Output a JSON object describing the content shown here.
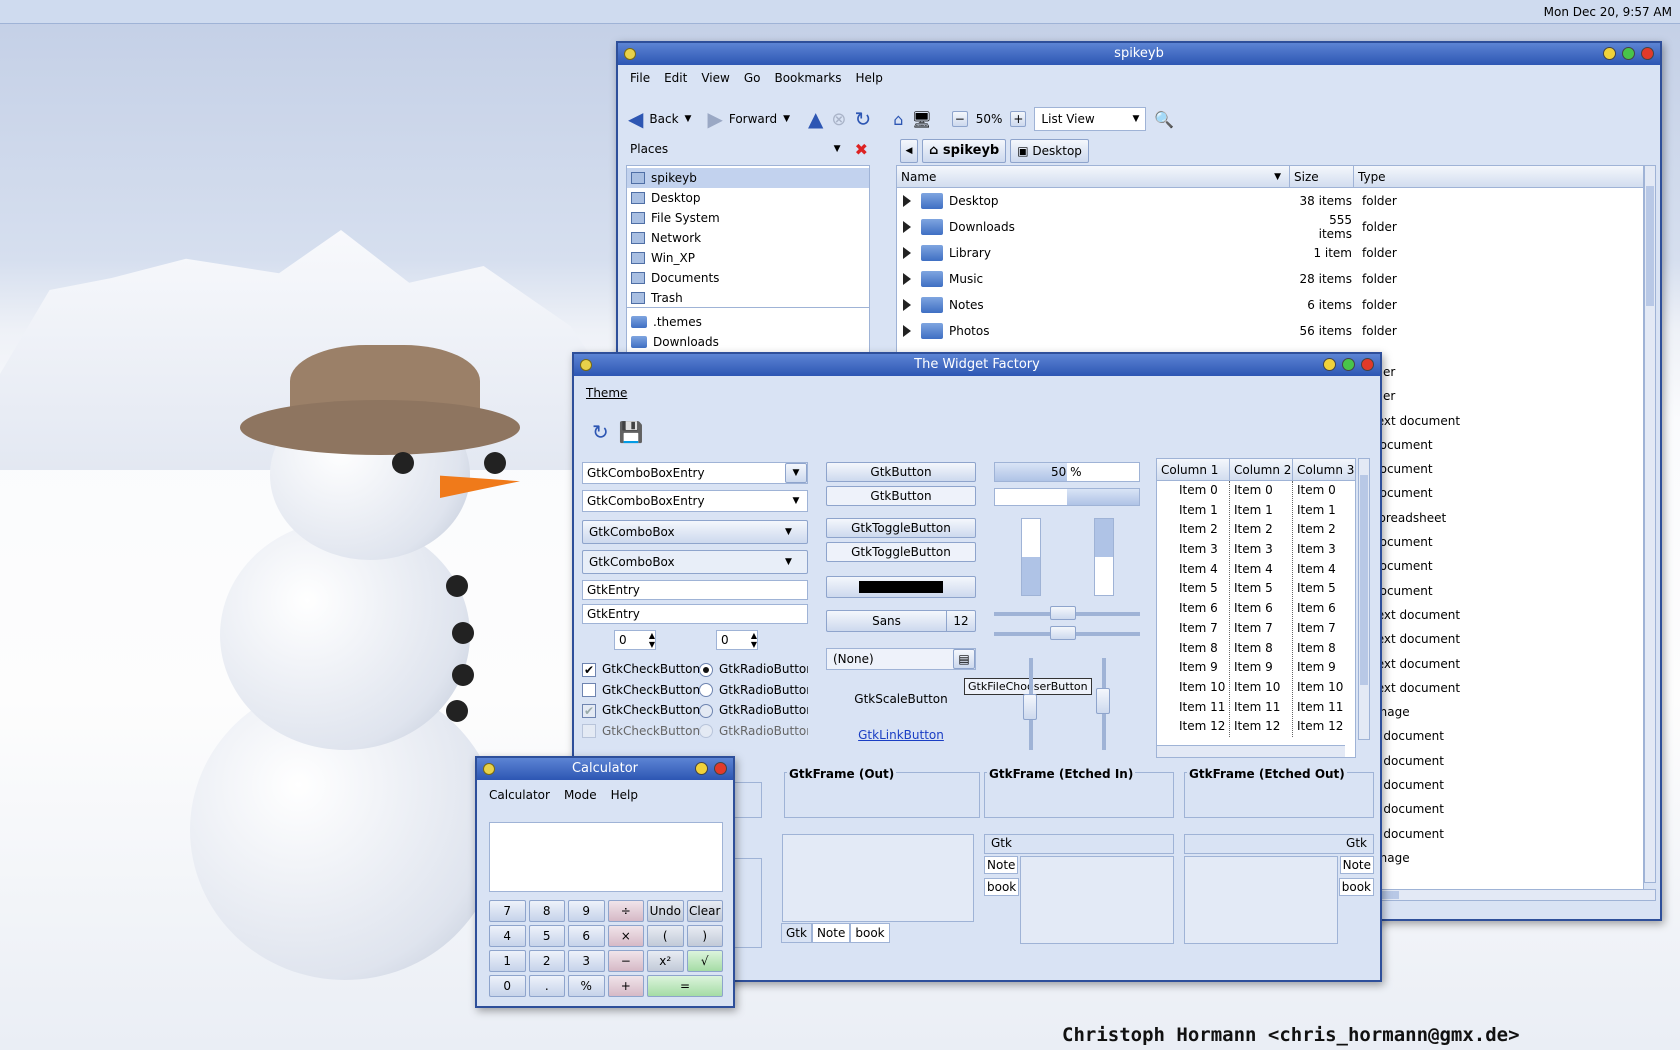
{
  "topbar": {
    "clock": "Mon Dec 20,  9:57 AM"
  },
  "signature": "Christoph Hormann <chris_hormann@gmx.de>",
  "nautilus": {
    "title": "spikeyb",
    "menu": [
      "File",
      "Edit",
      "View",
      "Go",
      "Bookmarks",
      "Help"
    ],
    "toolbar": {
      "back": "Back",
      "forward": "Forward",
      "zoom": "50%",
      "view_mode": "List View"
    },
    "places_label": "Places",
    "path": [
      "spikeyb",
      "Desktop"
    ],
    "places": [
      "spikeyb",
      "Desktop",
      "File System",
      "Network",
      "Win_XP",
      "Documents",
      "Trash"
    ],
    "bookmarks": [
      ".themes",
      "Downloads"
    ],
    "columns": {
      "name": "Name",
      "size": "Size",
      "type": "Type"
    },
    "rows": [
      {
        "name": "Desktop",
        "size": "38 items",
        "type": "folder"
      },
      {
        "name": "Downloads",
        "size": "555 items",
        "type": "folder"
      },
      {
        "name": "Library",
        "size": "1 item",
        "type": "folder"
      },
      {
        "name": "Music",
        "size": "28 items",
        "type": "folder"
      },
      {
        "name": "Notes",
        "size": "6 items",
        "type": "folder"
      },
      {
        "name": "Photos",
        "size": "56 items",
        "type": "folder"
      }
    ],
    "partial_types": [
      "lder",
      "lder",
      "text document",
      "document",
      "document",
      "document",
      "spreadsheet",
      "document",
      "document",
      "document",
      "text document",
      "text document",
      "text document",
      "text document",
      "Image",
      "d document",
      "d document",
      "d document",
      "d document",
      "d document",
      "Image"
    ]
  },
  "widget_factory": {
    "title": "The Widget Factory",
    "menu": "Theme",
    "combos": [
      "GtkComboBoxEntry",
      "GtkComboBoxEntry",
      "GtkComboBox",
      "GtkComboBox"
    ],
    "entries": [
      "GtkEntry",
      "GtkEntry"
    ],
    "spin1": "0",
    "spin2": "0",
    "checks": [
      {
        "label": "GtkCheckButton",
        "state": "checked"
      },
      {
        "label": "GtkCheckButton",
        "state": "unchecked"
      },
      {
        "label": "GtkCheckButton",
        "state": "inconsistent"
      },
      {
        "label": "GtkCheckButton",
        "state": "disabled"
      }
    ],
    "radios": [
      {
        "label": "GtkRadioButton",
        "state": "on"
      },
      {
        "label": "GtkRadioButton",
        "state": "off"
      },
      {
        "label": "GtkRadioButton",
        "state": "off"
      },
      {
        "label": "GtkRadioButton",
        "state": "disabled"
      }
    ],
    "buttons": [
      "GtkButton",
      "GtkButton",
      "GtkToggleButton",
      "GtkToggleButton"
    ],
    "font_button": {
      "name": "Sans",
      "size": "12"
    },
    "file_chooser": "(None)",
    "file_chooser_tooltip": "GtkFileChooserButton",
    "scale_button": "GtkScaleButton",
    "link_button": "GtkLinkButton",
    "progress": {
      "text": "50 %",
      "value": 0.5
    },
    "tree_columns": [
      "Column 1",
      "Column 2",
      "Column 3"
    ],
    "tree_items": [
      "Item 0",
      "Item 1",
      "Item 2",
      "Item 3",
      "Item 4",
      "Item 5",
      "Item 6",
      "Item 7",
      "Item 8",
      "Item 9",
      "Item 10",
      "Item 11",
      "Item 12"
    ],
    "frames": [
      "GtkFrame (Out)",
      "GtkFrame (Etched In)",
      "GtkFrame (Etched Out)"
    ],
    "notebook_tabs": [
      "Gtk",
      "Note",
      "book"
    ],
    "accent": "#2d56b3"
  },
  "calculator": {
    "title": "Calculator",
    "menu": [
      "Calculator",
      "Mode",
      "Help"
    ],
    "display": "",
    "keys": [
      [
        "7",
        "8",
        "9",
        "÷",
        "Undo",
        "Clear"
      ],
      [
        "4",
        "5",
        "6",
        "×",
        "(",
        ")"
      ],
      [
        "1",
        "2",
        "3",
        "−",
        "x²",
        "√"
      ],
      [
        "0",
        ".",
        "%",
        "+",
        "="
      ]
    ]
  }
}
